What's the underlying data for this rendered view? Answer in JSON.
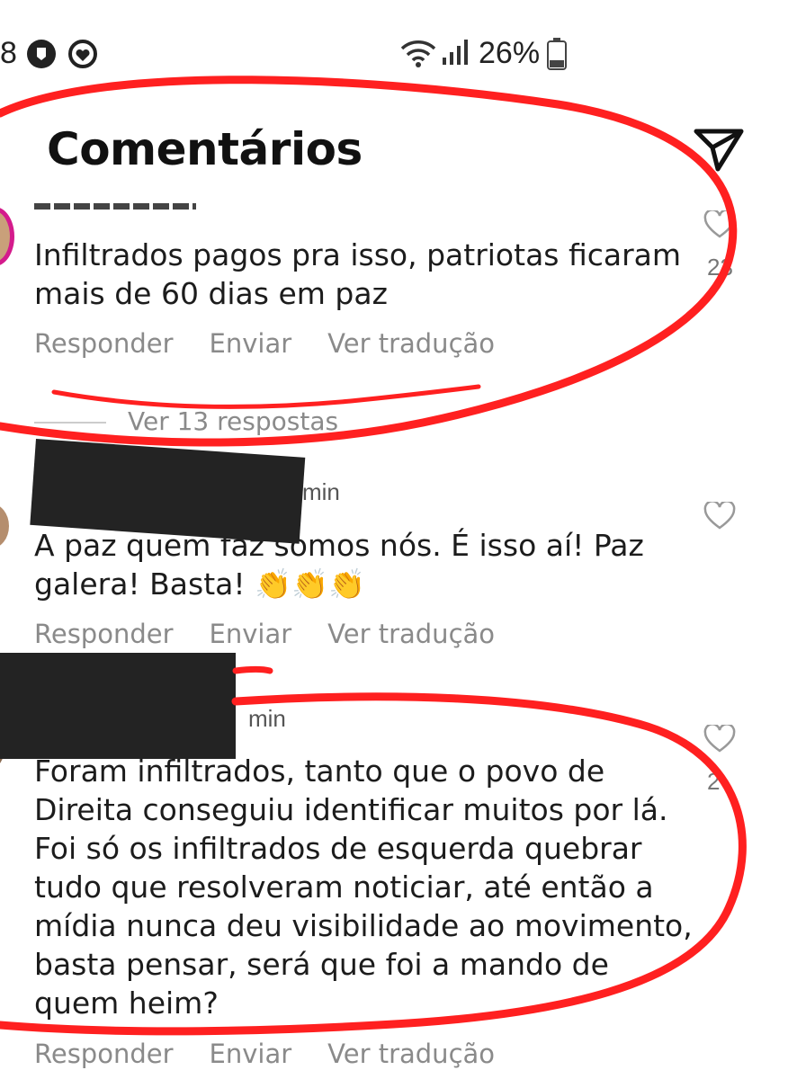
{
  "status_bar": {
    "time_fragment": "8",
    "battery_text": "26%"
  },
  "header": {
    "title": "Comentários"
  },
  "comments": [
    {
      "meta_fragment": "",
      "text": "Infiltrados pagos pra isso, patriotas ficaram mais de 60 dias em paz",
      "actions": [
        "Responder",
        "Enviar",
        "Ver tradução"
      ],
      "like_count": "23"
    },
    {
      "meta_fragment": "min",
      "text": "A paz quem faz somos nós. É isso aí! Paz galera! Basta! 👏👏👏",
      "actions": [
        "Responder",
        "Enviar",
        "Ver tradução"
      ]
    },
    {
      "meta_fragment": "min",
      "text": "Foram infiltrados, tanto que o povo de Direita conseguiu identificar muitos por lá. Foi só os infiltrados de esquerda quebrar tudo que resolveram noticiar, até então a mídia nunca deu visibilidade ao movimento, basta pensar, será que foi a mando de quem heim?",
      "actions": [
        "Responder",
        "Enviar",
        "Ver tradução"
      ],
      "like_count": "2"
    }
  ],
  "view_replies": "Ver 13 respostas",
  "colors": {
    "annotation": "#ff2020",
    "redaction": "#232323",
    "muted_text": "#8a8a8a"
  },
  "icons": [
    "wifi-icon",
    "signal-icon",
    "battery-icon",
    "send-icon",
    "heart-icon"
  ]
}
